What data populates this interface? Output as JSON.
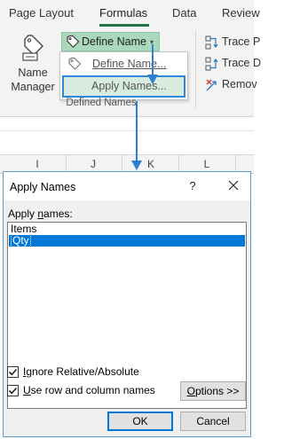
{
  "ribbon": {
    "tabs": [
      "Page Layout",
      "Formulas",
      "Data",
      "Review"
    ],
    "active_tab": "Formulas",
    "accent": "#217346",
    "name_manager": {
      "line1": "Name",
      "line2": "Manager",
      "icon": "name-tag-icon"
    },
    "define_name": {
      "label": "Define Name",
      "icon": "tag-icon",
      "caret": "▾"
    },
    "menu": {
      "item1": {
        "label": "Define Name...",
        "icon": "tag-icon"
      },
      "item2": {
        "label": "Apply Names..."
      }
    },
    "group_label": "Defined Names",
    "auditing": [
      {
        "label": "Trace P",
        "icon": "trace-precedents-icon"
      },
      {
        "label": "Trace D",
        "icon": "trace-dependents-icon"
      },
      {
        "label": "Remov",
        "icon": "remove-arrows-icon"
      }
    ]
  },
  "sheet": {
    "columns": [
      "I",
      "J",
      "K",
      "L"
    ]
  },
  "dialog": {
    "title": "Apply Names",
    "help": "?",
    "close": "✕",
    "list_label_pre": "Apply ",
    "list_label_accel": "n",
    "list_label_post": "ames:",
    "names": [
      "Items",
      "Qty"
    ],
    "selected_name": "Qty",
    "selection_color": "#0078d7",
    "ignore_relative": {
      "accel": "I",
      "rest": "gnore Relative/Absolute",
      "checked": true
    },
    "use_row_col": {
      "accel": "U",
      "rest": "se row and column names",
      "checked": true
    },
    "options_button": {
      "accel": "O",
      "rest": "ptions >>"
    },
    "ok_button": "OK",
    "cancel_button": "Cancel"
  }
}
